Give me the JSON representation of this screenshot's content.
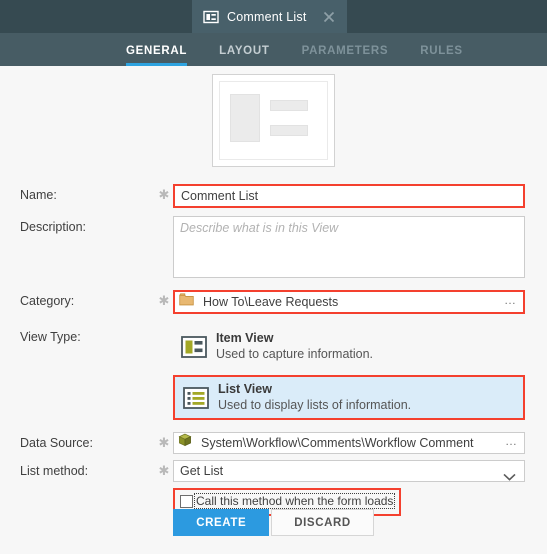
{
  "titlebar": {
    "tab": {
      "label": "Comment List",
      "icon": "list-view-icon",
      "close_icon": "close-icon"
    }
  },
  "nav": {
    "tabs": [
      {
        "label": "GENERAL",
        "state": "active"
      },
      {
        "label": "LAYOUT",
        "state": "normal"
      },
      {
        "label": "PARAMETERS",
        "state": "dim"
      },
      {
        "label": "RULES",
        "state": "dim"
      }
    ]
  },
  "preview": {
    "icon": "list-view-preview-icon"
  },
  "form": {
    "name": {
      "label": "Name:",
      "required_marker": "✱",
      "value": "Comment List",
      "highlighted": true
    },
    "description": {
      "label": "Description:",
      "placeholder": "Describe what is in this View",
      "value": ""
    },
    "category": {
      "label": "Category:",
      "required_marker": "✱",
      "value": "How To\\Leave Requests",
      "icon": "folder-icon",
      "browse_label": "…",
      "highlighted": true
    },
    "view_type": {
      "label": "View Type:",
      "options": [
        {
          "title": "Item View",
          "description": "Used to capture information.",
          "icon": "item-view-icon",
          "selected": false,
          "highlighted": false
        },
        {
          "title": "List View",
          "description": "Used to display lists of information.",
          "icon": "list-view-icon",
          "selected": true,
          "highlighted": true
        }
      ]
    },
    "data_source": {
      "label": "Data Source:",
      "required_marker": "✱",
      "value": "System\\Workflow\\Comments\\Workflow Comment",
      "icon": "smartobject-cube-icon",
      "browse_label": "…"
    },
    "list_method": {
      "label": "List method:",
      "required_marker": "✱",
      "value": "Get List",
      "dropdown_icon": "chevron-down-icon"
    },
    "call_on_load": {
      "label": "Call this method when the form loads",
      "checked": false,
      "highlighted": true
    }
  },
  "footer": {
    "create_label": "CREATE",
    "discard_label": "DISCARD"
  },
  "colors": {
    "titlebar": "#364a51",
    "tab_active": "#48606a",
    "navbar": "#475c64",
    "accent_blue": "#2ea3e0",
    "highlight_red": "#f4402e",
    "selection_blue": "#daecf9",
    "olive": "#a3a826",
    "folder_tan": "#e8b871",
    "page_bg": "#f7f7f7"
  }
}
